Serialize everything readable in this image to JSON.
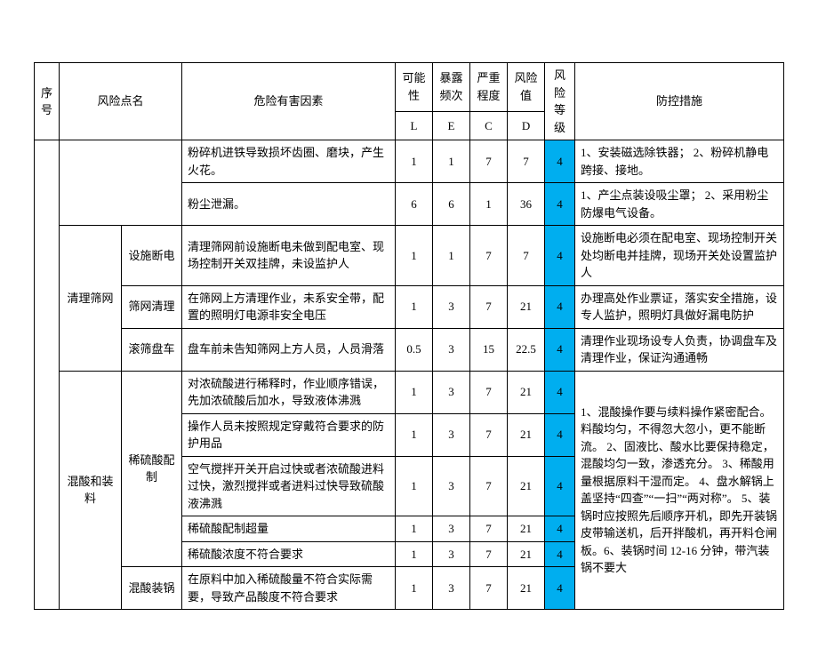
{
  "headers": {
    "seq": "序号",
    "risk_point": "风险点名",
    "hazard": "危险有害因素",
    "likelihood": "可能性",
    "exposure": "暴露频次",
    "severity": "严重程度",
    "risk_value": "风险值",
    "level": "风险等级",
    "measure": "防控措施",
    "L": "L",
    "E": "E",
    "C": "C",
    "D": "D"
  },
  "rows": [
    {
      "hazard": "粉碎机进铁导致损坏齿圈、磨块，产生火花。",
      "L": "1",
      "E": "1",
      "C": "7",
      "D": "7",
      "level": "4",
      "measure": "1、安装磁选除铁器；\n2、粉碎机静电跨接、接地。"
    },
    {
      "hazard": "粉尘泄漏。",
      "L": "6",
      "E": "6",
      "C": "1",
      "D": "36",
      "level": "4",
      "measure": "1、产尘点装设吸尘罩；\n2、采用粉尘防爆电气设备。"
    }
  ],
  "group_clean": {
    "name": "清理筛网",
    "rows": [
      {
        "sub": "设施断电",
        "hazard": "清理筛网前设施断电未做到配电室、现场控制开关双挂牌，未设监护人",
        "L": "1",
        "E": "1",
        "C": "7",
        "D": "7",
        "level": "4",
        "measure": "设施断电必须在配电室、现场控制开关处均断电并挂牌，现场开关处设置监护人"
      },
      {
        "sub": "筛网清理",
        "hazard": "在筛网上方清理作业，未系安全带，配置的照明灯电源非安全电压",
        "L": "1",
        "E": "3",
        "C": "7",
        "D": "21",
        "level": "4",
        "measure": "办理高处作业票证，落实安全措施，设专人监护，照明灯具做好漏电防护"
      },
      {
        "sub": "滚筛盘车",
        "hazard": "盘车前未告知筛网上方人员，人员滑落",
        "L": "0.5",
        "E": "3",
        "C": "15",
        "D": "22.5",
        "level": "4",
        "measure": "清理作业现场设专人负责，协调盘车及清理作业，保证沟通通畅"
      }
    ]
  },
  "group_acid": {
    "name": "混酸和装料",
    "sub1": "稀硫酸配制",
    "sub2": "混酸装锅",
    "rows": [
      {
        "hazard": "对浓硫酸进行稀释时，作业顺序错误，先加浓硫酸后加水，导致液体沸溅",
        "L": "1",
        "E": "3",
        "C": "7",
        "D": "21",
        "level": "4"
      },
      {
        "hazard": "操作人员未按照规定穿戴符合要求的防护用品",
        "L": "1",
        "E": "3",
        "C": "7",
        "D": "21",
        "level": "4"
      },
      {
        "hazard": "空气搅拌开关开启过快或者浓硫酸进料过快，激烈搅拌或者进料过快导致硫酸液沸溅",
        "L": "1",
        "E": "3",
        "C": "7",
        "D": "21",
        "level": "4"
      },
      {
        "hazard": "稀硫酸配制超量",
        "L": "1",
        "E": "3",
        "C": "7",
        "D": "21",
        "level": "4"
      },
      {
        "hazard": "稀硫酸浓度不符合要求",
        "L": "1",
        "E": "3",
        "C": "7",
        "D": "21",
        "level": "4"
      },
      {
        "hazard": "在原料中加入稀硫酸量不符合实际需要，导致产品酸度不符合要求",
        "L": "1",
        "E": "3",
        "C": "7",
        "D": "21",
        "level": "4"
      }
    ],
    "measure": "1、混酸操作要与续料操作紧密配合。料酸均匀，不得忽大忽小，更不能断流。\n2、固液比、酸水比要保持稳定，混酸均匀一致，渗透充分。\n3、稀酸用量根据原料干湿而定。\n4、盘水解锅上盖坚持“四查”“一扫”“两对称”。\n5、装锅时应按照先后顺序开机，即先开装锅皮带输送机，后开拌酸机，再开料仓闸板。6、装锅时间 12-16 分钟，带汽装锅不要大"
  }
}
